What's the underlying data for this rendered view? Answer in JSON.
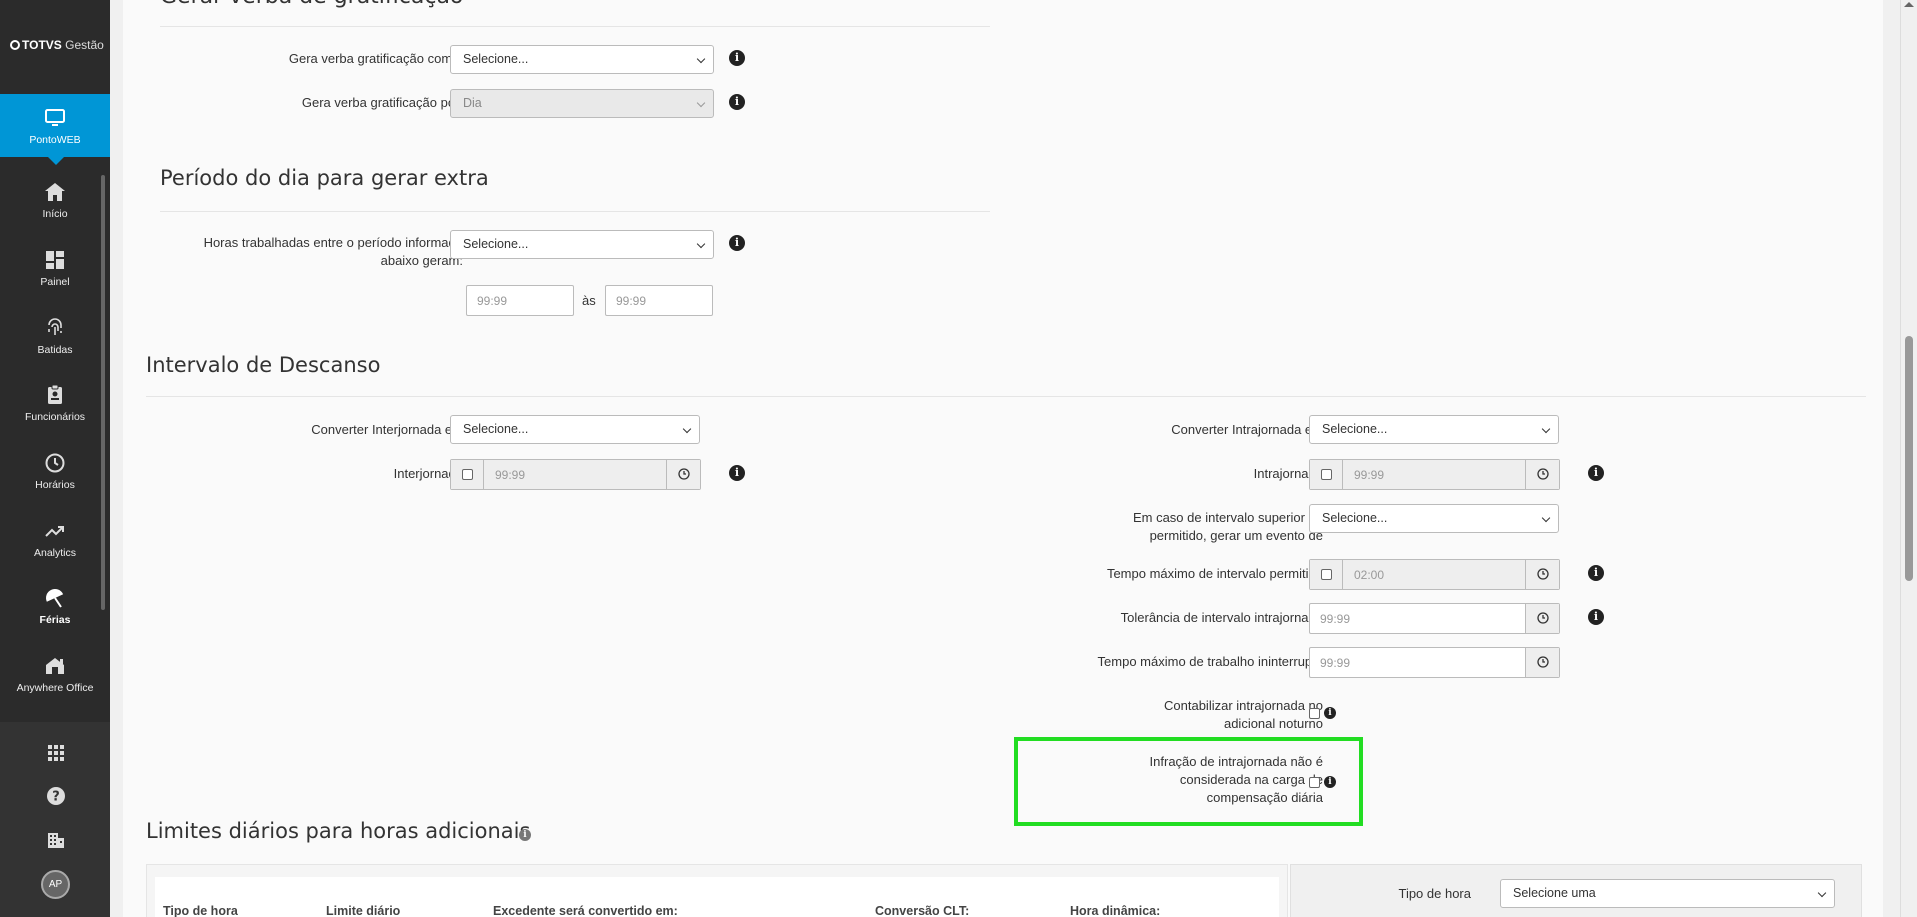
{
  "app": {
    "logo_brand": "TOTVS",
    "logo_suffix": "Gestão",
    "accent": "#0096d6",
    "highlight": "#22dd22"
  },
  "sidebar": {
    "items": [
      {
        "label": "PontoWEB",
        "icon": "monitor-icon"
      },
      {
        "label": "Início",
        "icon": "home-icon"
      },
      {
        "label": "Painel",
        "icon": "dashboard-icon"
      },
      {
        "label": "Batidas",
        "icon": "fingerprint-icon"
      },
      {
        "label": "Funcionários",
        "icon": "badge-icon"
      },
      {
        "label": "Horários",
        "icon": "clock-icon"
      },
      {
        "label": "Analytics",
        "icon": "trend-icon"
      },
      {
        "label": "Férias",
        "icon": "umbrella-icon"
      },
      {
        "label": "Anywhere Office",
        "icon": "house-office-icon"
      }
    ],
    "bottom": {
      "apps": "apps-grid-icon",
      "help": "help-icon",
      "company": "building-icon",
      "avatar": "AP"
    }
  },
  "sections": {
    "gratificacao": {
      "title": "Gerar verba de gratificação",
      "como_label": "Gera verba gratificação como:",
      "como_value": "Selecione...",
      "por_label": "Gera verba gratificação por:",
      "por_value": "Dia"
    },
    "periodo": {
      "title": "Período do dia para gerar extra",
      "horas_label": "Horas trabalhadas entre o período informado abaixo geram:",
      "horas_value": "Selecione...",
      "from_placeholder": "99:99",
      "between": "às",
      "to_placeholder": "99:99"
    },
    "intervalo": {
      "title": "Intervalo de Descanso",
      "conv_inter_label": "Converter Interjornada em",
      "conv_inter_value": "Selecione...",
      "inter_label": "Interjornada",
      "inter_value": "99:99",
      "conv_intra_label": "Converter Intrajornada em",
      "conv_intra_value": "Selecione...",
      "intra_label": "Intrajornada",
      "intra_value": "99:99",
      "superior_label": "Em caso de intervalo superior ao permitido, gerar um evento de",
      "superior_value": "Selecione...",
      "tempo_max_label": "Tempo máximo de intervalo permitido",
      "tempo_max_value": "02:00",
      "tolerancia_label": "Tolerância de intervalo intrajornada",
      "tolerancia_value": "99:99",
      "ininterrupto_label": "Tempo máximo de trabalho ininterrupto",
      "ininterrupto_value": "99:99",
      "noturno_label": "Contabilizar intrajornada no adicional noturno",
      "infracao_label": "Infração de intrajornada não é considerada na carga de compensação diária"
    },
    "limites": {
      "title": "Limites diários para horas adicionais",
      "columns": [
        "Tipo de hora",
        "Limite diário",
        "Excedente será convertido em:",
        "Conversão CLT:",
        "Hora dinâmica:"
      ],
      "tipo_label": "Tipo de hora",
      "tipo_value": "Selecione uma"
    }
  }
}
